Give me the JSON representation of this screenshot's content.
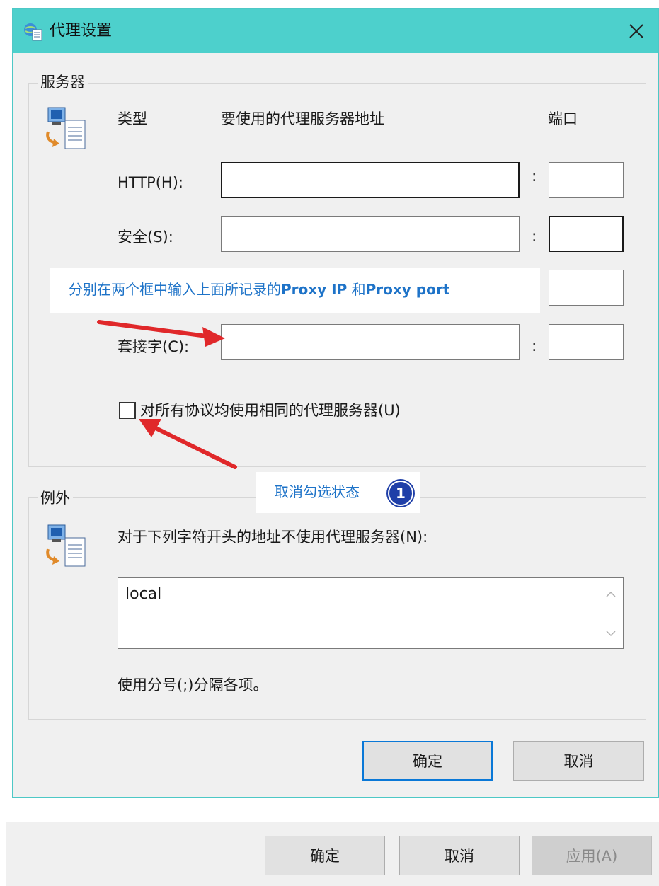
{
  "dialog": {
    "title": "代理设置",
    "close_glyph": "✕"
  },
  "servers": {
    "legend": "服务器",
    "col_type": "类型",
    "col_address": "要使用的代理服务器地址",
    "col_port": "端口",
    "rows": [
      {
        "label": "HTTP(H):",
        "address": "",
        "port": ""
      },
      {
        "label": "安全(S):",
        "address": "",
        "port": ""
      },
      {
        "label": "套接字(C):",
        "address": "",
        "port": ""
      }
    ],
    "colon": ":",
    "same_proxy_label": "对所有协议均使用相同的代理服务器(U)",
    "same_proxy_checked": false
  },
  "exceptions": {
    "legend": "例外",
    "description": "对于下列字符开头的地址不使用代理服务器(N):",
    "value": "local",
    "hint": "使用分号(;)分隔各项。"
  },
  "buttons": {
    "ok": "确定",
    "cancel": "取消"
  },
  "background_buttons": {
    "ok": "确定",
    "cancel": "取消",
    "apply": "应用(A)"
  },
  "annotations": {
    "note1_prefix": "分别在两个框中输入上面所记录的",
    "note1_bold1": "Proxy IP",
    "note1_mid": " 和",
    "note1_bold2": "Proxy port",
    "note2": "取消勾选状态",
    "badge": "1"
  },
  "colors": {
    "titlebar": "#4dd0cc",
    "annotation_text": "#1e73c8",
    "arrow": "#e0282a",
    "badge": "#1f3fa8"
  }
}
